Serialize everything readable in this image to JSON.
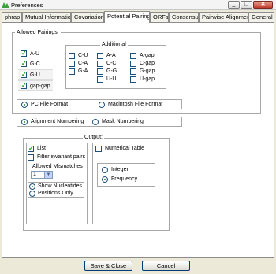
{
  "window": {
    "title": "Preferences"
  },
  "tabs": [
    {
      "label": "phrap"
    },
    {
      "label": "Mutual Information"
    },
    {
      "label": "Covariation"
    },
    {
      "label": "Potential Pairings"
    },
    {
      "label": "ORFs"
    },
    {
      "label": "Consensus"
    },
    {
      "label": "Pairwise Alignment"
    },
    {
      "label": "General"
    }
  ],
  "allowed_pairings": {
    "title": "Allowed Pairings:",
    "items": [
      {
        "label": "A-U",
        "checked": true
      },
      {
        "label": "G-C",
        "checked": true
      },
      {
        "label": "G-U",
        "checked": true
      },
      {
        "label": "gap-gap",
        "checked": true
      }
    ]
  },
  "additional": {
    "title": "Additional",
    "columns": [
      [
        {
          "label": "C-U"
        },
        {
          "label": "C-A"
        },
        {
          "label": "G-A"
        }
      ],
      [
        {
          "label": "A-A"
        },
        {
          "label": "C-C"
        },
        {
          "label": "G-G"
        },
        {
          "label": "U-U"
        }
      ],
      [
        {
          "label": "A-gap"
        },
        {
          "label": "C-gap"
        },
        {
          "label": "G-gap"
        },
        {
          "label": "U-gap"
        }
      ]
    ]
  },
  "file_format": {
    "options": [
      {
        "label": "PC File Format",
        "selected": true
      },
      {
        "label": "Macintosh File Format",
        "selected": false
      }
    ]
  },
  "numbering": {
    "options": [
      {
        "label": "Alignment Numbering",
        "selected": true
      },
      {
        "label": "Mask Numbering",
        "selected": false
      }
    ]
  },
  "output": {
    "title": "Output:",
    "list_label": "List",
    "list_checked": true,
    "filter_label": "Filter invariant pairs",
    "filter_checked": false,
    "mismatches_label": "Allowed Mismatches",
    "mismatches_value": "1",
    "show_nucleotides_label": "Show Nucleotides",
    "positions_only_label": "Positions Only",
    "numerical_table_label": "Numerical Table",
    "integer_label": "Integer",
    "frequency_label": "Frequency"
  },
  "buttons": {
    "save_close": "Save & Close",
    "cancel": "Cancel"
  },
  "colors": {
    "check": "#21a121",
    "window_bg": "#ece9d8",
    "button_border": "#003c74"
  }
}
